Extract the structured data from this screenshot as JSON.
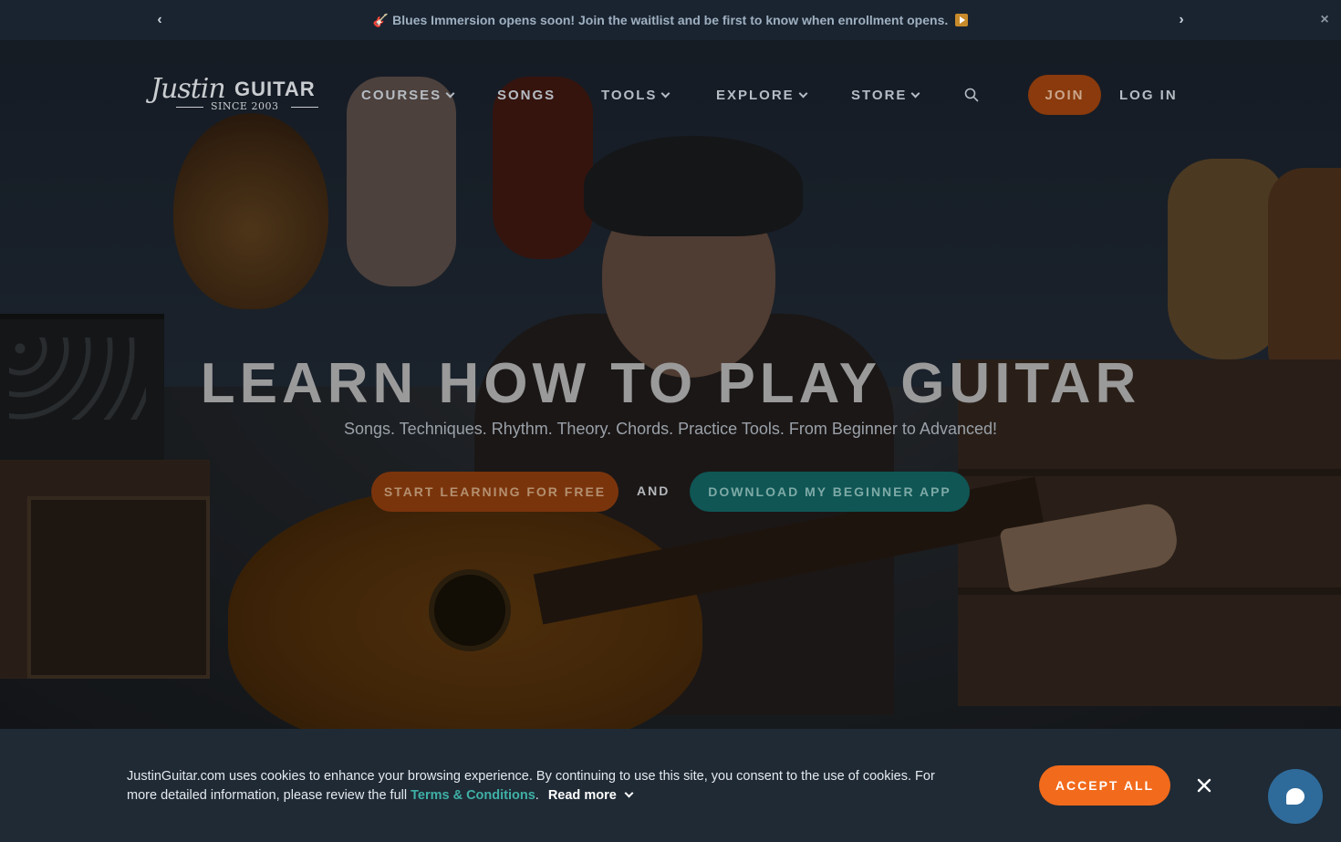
{
  "announcement": {
    "emoji": "🎸",
    "text": "Blues Immersion opens soon! Join the waitlist and be first to know when enrollment opens.",
    "prev_icon": "‹",
    "next_icon": "›",
    "close_icon": "×"
  },
  "logo": {
    "justin": "Justin",
    "guitar": "GUITAR",
    "since": "SINCE 2003"
  },
  "nav": {
    "items": [
      {
        "label": "COURSES",
        "has_dropdown": true
      },
      {
        "label": "SONGS",
        "has_dropdown": false
      },
      {
        "label": "TOOLS",
        "has_dropdown": true
      },
      {
        "label": "EXPLORE",
        "has_dropdown": true
      },
      {
        "label": "STORE",
        "has_dropdown": true
      }
    ],
    "join_label": "JOIN",
    "login_label": "LOG IN"
  },
  "hero": {
    "headline": "LEARN HOW TO PLAY GUITAR",
    "subheadline": "Songs. Techniques. Rhythm. Theory. Chords. Practice Tools. From Beginner to Advanced!",
    "cta_primary": "START LEARNING FOR FREE",
    "and_text": "AND",
    "cta_secondary": "DOWNLOAD MY BEGINNER APP"
  },
  "cookie": {
    "text_before": "JustinGuitar.com uses cookies to enhance your browsing experience. By continuing to use this site, you consent to the use of cookies. For more detailed information, please review the full ",
    "link": "Terms & Conditions",
    "period": ".",
    "read_more": "Read more",
    "accept": "ACCEPT ALL"
  },
  "colors": {
    "accent_orange": "#f26a1b",
    "teal": "#0f5655",
    "banner_bg": "#1a2431",
    "cookie_bg": "#1f2a35",
    "chat_blue": "#2f6b9a"
  }
}
